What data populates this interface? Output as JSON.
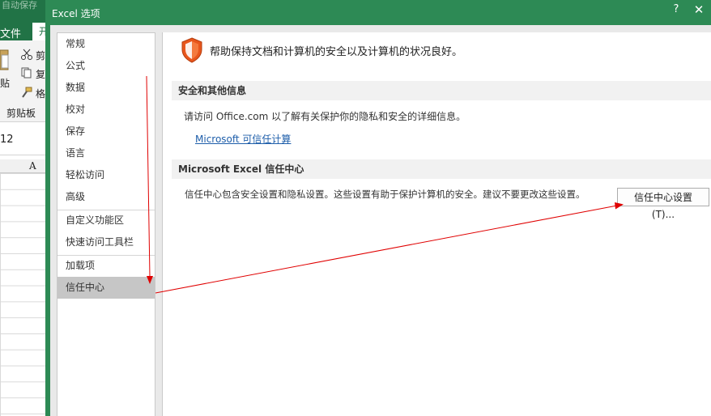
{
  "background": {
    "autosave": "自动保存",
    "title_fragment": "…",
    "tab_file": "文件",
    "tab_home": "开",
    "cut": "剪",
    "copy": "复",
    "paste": "贴",
    "format_painter": "格",
    "clipboard": "剪贴板",
    "font_size": "12",
    "column_a": "A"
  },
  "dialog": {
    "title": "Excel 选项",
    "help_button": "?",
    "close_button": "✕"
  },
  "nav": {
    "items": [
      "常规",
      "公式",
      "数据",
      "校对",
      "保存",
      "语言",
      "轻松访问",
      "高级",
      "自定义功能区",
      "快速访问工具栏",
      "加载项",
      "信任中心"
    ],
    "selected": "信任中心"
  },
  "content": {
    "intro": "帮助保持文档和计算机的安全以及计算机的状况良好。",
    "section_privacy": "安全和其他信息",
    "privacy_text": "请访问 Office.com  以了解有关保护你的隐私和安全的详细信息。",
    "privacy_link": "Microsoft 可信任计算",
    "section_trust_center": "Microsoft Excel 信任中心",
    "trust_center_text": "信任中心包含安全设置和隐私设置。这些设置有助于保护计算机的安全。建议不要更改这些设置。",
    "trust_center_button": "信任中心设置(T)..."
  },
  "colors": {
    "excel_green": "#217346",
    "dialog_frame": "#2d8a55",
    "shield_orange": "#e8561c",
    "link_blue": "#1e5eaa",
    "annotation_red": "#e00000"
  }
}
